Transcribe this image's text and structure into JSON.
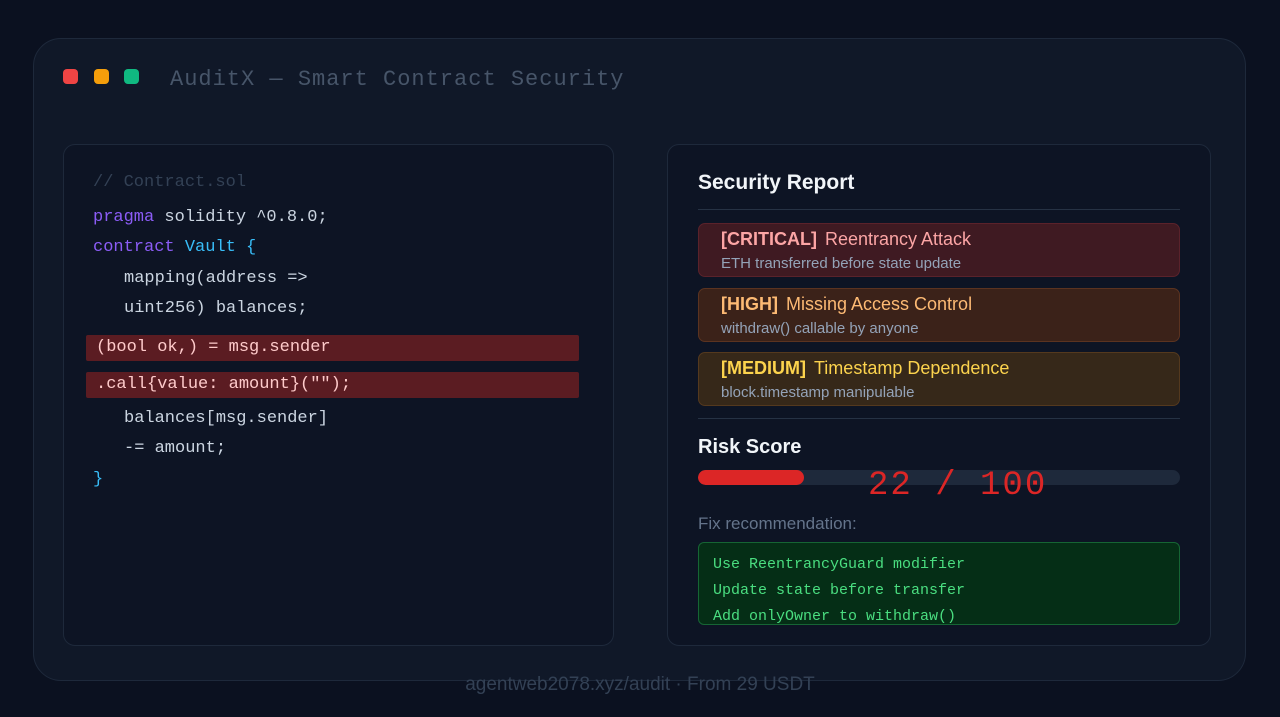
{
  "window": {
    "title": "AuditX — Smart Contract Security"
  },
  "code": {
    "comment": "// Contract.sol",
    "line1_kw": "pragma",
    "line1_rest": " solidity ^0.8.0;",
    "line2_kw": "contract",
    "line2_name": " Vault",
    "line2_brace": " {",
    "line3": "mapping(address =>",
    "line4": "uint256) balances;",
    "highlight1": "(bool ok,) = msg.sender",
    "highlight2": ".call{value: amount}(\"\");",
    "line5": "balances[msg.sender]",
    "line6": "-= amount;",
    "closing": "}"
  },
  "report": {
    "title": "Security Report",
    "issues": [
      {
        "severity": "[CRITICAL]",
        "name": "Reentrancy Attack",
        "desc": "ETH transferred before state update"
      },
      {
        "severity": "[HIGH]",
        "name": "Missing Access Control",
        "desc": "withdraw() callable by anyone"
      },
      {
        "severity": "[MEDIUM]",
        "name": "Timestamp Dependence",
        "desc": "block.timestamp manipulable"
      }
    ],
    "risk_label": "Risk Score",
    "risk_score": 22,
    "risk_max": 100,
    "risk_text": "22 / 100",
    "fix_label": "Fix recommendation:",
    "fixes": [
      "Use ReentrancyGuard modifier",
      "Update state before transfer",
      "Add onlyOwner to withdraw()"
    ]
  },
  "footer": "agentweb2078.xyz/audit · From 29 USDT",
  "colors": {
    "critical": "#fca5a5",
    "high": "#fdba74",
    "medium": "#fcd34d",
    "risk": "#dc2626",
    "fix_text": "#4ade80"
  }
}
